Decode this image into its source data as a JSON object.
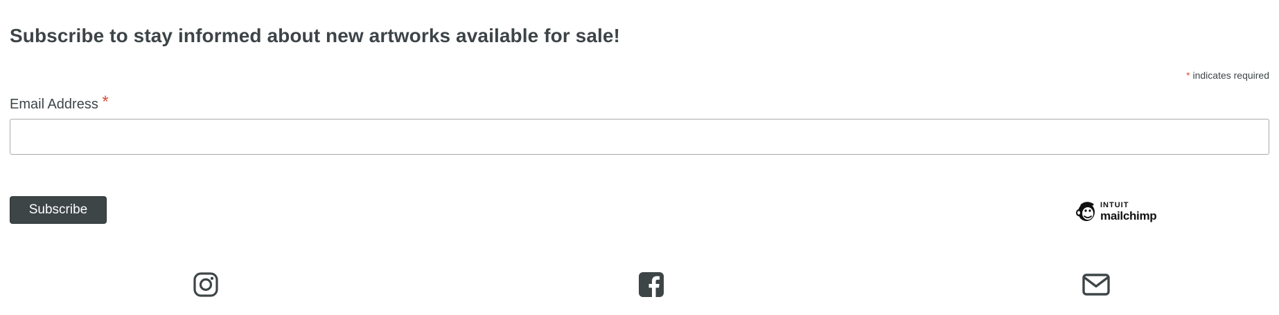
{
  "form": {
    "heading": "Subscribe to stay informed about new artworks available for sale!",
    "required_marker": "*",
    "required_note": "indicates required",
    "email_label": "Email Address",
    "email_required_marker": "*",
    "email_value": "",
    "subscribe_label": "Subscribe"
  },
  "branding": {
    "logo_icon": "mailchimp-freddie-icon",
    "top_text": "INTUIT",
    "bottom_text": "mailchimp"
  },
  "social": {
    "items": [
      {
        "name": "instagram",
        "icon": "instagram-icon"
      },
      {
        "name": "facebook",
        "icon": "facebook-icon"
      },
      {
        "name": "email",
        "icon": "envelope-icon"
      }
    ]
  },
  "colors": {
    "text": "#3d4447",
    "button_bg": "#3e4547",
    "required": "#d94f3a",
    "input_border": "#a9a9a9"
  }
}
